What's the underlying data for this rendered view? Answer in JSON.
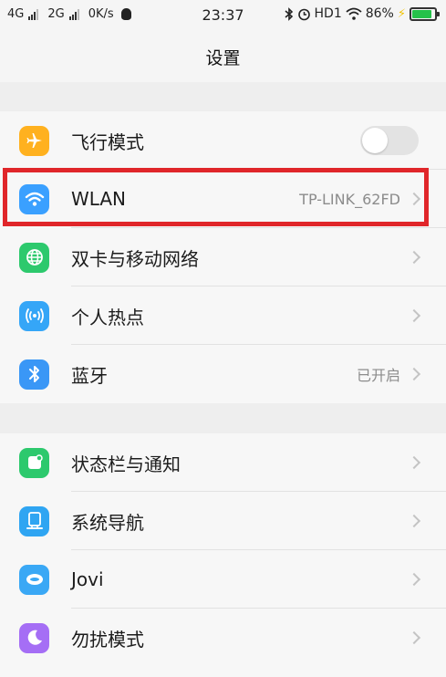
{
  "status_bar": {
    "net1": "4G",
    "net2": "2G",
    "speed": "0K/s",
    "time": "23:37",
    "hd": "HD1",
    "battery_percent": "86%",
    "battery_level": 0.86
  },
  "header": {
    "title": "设置"
  },
  "groups": [
    {
      "items": [
        {
          "label": "飞行模式",
          "icon": "airplane-icon",
          "color": "#ffb11f",
          "toggle": false
        },
        {
          "label": "WLAN",
          "value": "TP-LINK_62FD",
          "icon": "wifi-icon",
          "color": "#3aa0ff",
          "highlighted": true
        },
        {
          "label": "双卡与移动网络",
          "icon": "globe-icon",
          "color": "#2dc96d"
        },
        {
          "label": "个人热点",
          "icon": "hotspot-icon",
          "color": "#35a6f7"
        },
        {
          "label": "蓝牙",
          "value": "已开启",
          "icon": "bluetooth-icon",
          "color": "#3a97f6"
        }
      ]
    },
    {
      "items": [
        {
          "label": "状态栏与通知",
          "icon": "notification-icon",
          "color": "#2dc96d"
        },
        {
          "label": "系统导航",
          "icon": "navigation-icon",
          "color": "#2fa5f2"
        },
        {
          "label": "Jovi",
          "icon": "jovi-icon",
          "color": "#3aa8f5"
        },
        {
          "label": "勿扰模式",
          "icon": "moon-icon",
          "color": "#a56ef5"
        }
      ]
    }
  ]
}
